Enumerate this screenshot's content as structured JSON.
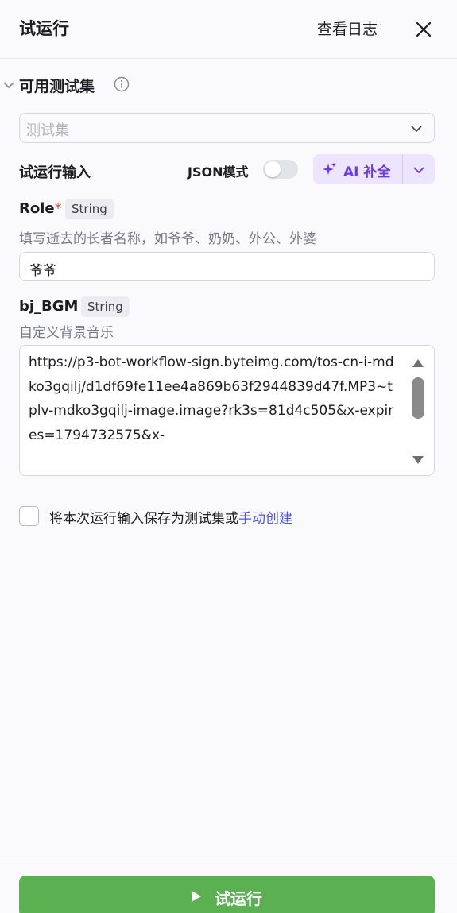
{
  "header": {
    "title": "试运行",
    "view_log": "查看日志",
    "close_icon": "close-icon"
  },
  "test_set": {
    "title": "可用测试集",
    "select_placeholder": "测试集"
  },
  "run_input": {
    "label": "试运行输入",
    "json_mode_label": "JSON模式",
    "json_mode_on": false,
    "ai_fill_label": "AI 补全"
  },
  "fields": [
    {
      "name": "Role",
      "required_mark": "*",
      "type": "String",
      "description": "填写逝去的长者名称，如爷爷、奶奶、外公、外婆",
      "value": "爷爷"
    },
    {
      "name": "bj_BGM",
      "type": "String",
      "description": "自定义背景音乐",
      "value": "https://p3-bot-workflow-sign.byteimg.com/tos-cn-i-mdko3gqilj/d1df69fe11ee4a869b63f2944839d47f.MP3~tplv-mdko3gqilj-image.image?rk3s=81d4c505&x-expires=1794732575&x-"
    }
  ],
  "save": {
    "checked": false,
    "text": "将本次运行输入保存为测试集或",
    "link": "手动创建"
  },
  "footer": {
    "run_label": "试运行"
  },
  "colors": {
    "accent_green": "#5bb152",
    "ai_purple": "#6c3be0",
    "link_blue": "#4d53e8",
    "required_red": "#e5484d"
  }
}
